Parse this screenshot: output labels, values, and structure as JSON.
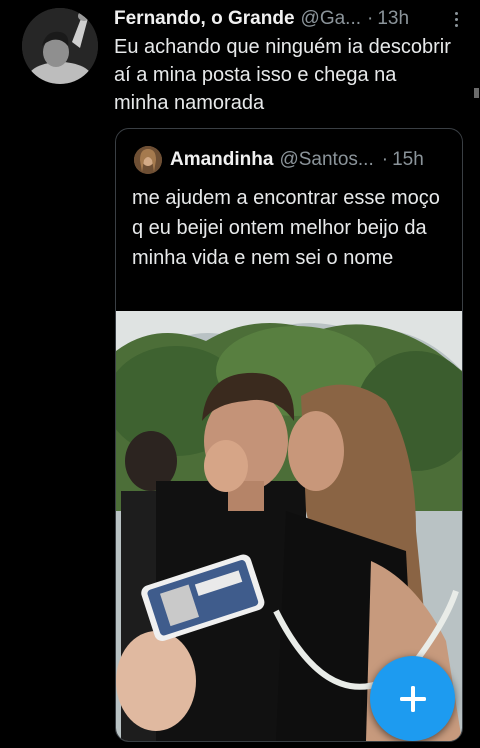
{
  "tweet": {
    "author_name": "Fernando, o Grande",
    "author_handle": "@Ga...",
    "separator": "·",
    "time": "13h",
    "text": "Eu achando que ninguém ia descobrir aí a mina posta isso e chega na minha namorada",
    "more_icon": "more-vertical-icon"
  },
  "quoted_tweet": {
    "author_name": "Amandinha",
    "author_handle": "@Santos...",
    "separator": "·",
    "time": "15h",
    "text": "me ajudem a encontrar esse moço q eu beijei ontem melhor beijo da minha vida e nem sei o nome"
  },
  "compose_button": {
    "icon": "plus-icon",
    "color": "#1d9bf0"
  },
  "colors": {
    "background": "#000000",
    "text": "#e7e9ea",
    "secondary_text": "#8b949a",
    "border": "#3a3f44",
    "accent": "#1d9bf0"
  }
}
